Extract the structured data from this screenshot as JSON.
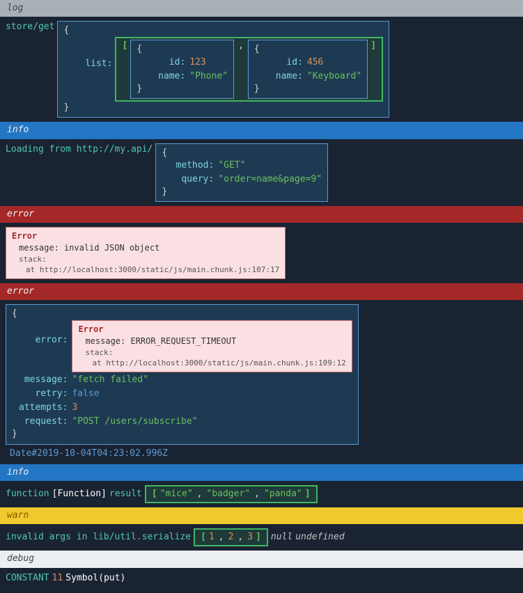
{
  "sections": {
    "log": {
      "header": "log",
      "prefix": "store/get",
      "obj": {
        "list_key": "list:",
        "items": [
          {
            "id_key": "id:",
            "id_val": "123",
            "name_key": "name:",
            "name_val": "\"Phone\""
          },
          {
            "id_key": "id:",
            "id_val": "456",
            "name_key": "name:",
            "name_val": "\"Keyboard\""
          }
        ]
      }
    },
    "info1": {
      "header": "info",
      "prefix": "Loading from http://my.api/",
      "obj": {
        "method_key": "method:",
        "method_val": "\"GET\"",
        "query_key": "query:",
        "query_val": "\"order=name&page=9\""
      }
    },
    "error1": {
      "header": "error",
      "error": {
        "title": "Error",
        "message_label": "message:",
        "message": "invalid JSON object",
        "stack_label": "stack:",
        "stack_line": "at http://localhost:3000/static/js/main.chunk.js:107:17"
      }
    },
    "error2": {
      "header": "error",
      "date": "Date#2019-10-04T04:23:02.996Z",
      "obj": {
        "error_key": "error:",
        "inner_error": {
          "title": "Error",
          "message_label": "message:",
          "message": "ERROR_REQUEST_TIMEOUT",
          "stack_label": "stack:",
          "stack_line": "at http://localhost:3000/static/js/main.chunk.js:109:12"
        },
        "message_key": "message:",
        "message_val": "\"fetch failed\"",
        "retry_key": "retry:",
        "retry_val": "false",
        "attempts_key": "attempts:",
        "attempts_val": "3",
        "request_key": "request:",
        "request_val": "\"POST /users/subscribe\""
      }
    },
    "info2": {
      "header": "info",
      "t1": "function",
      "t2": "[Function]",
      "t3": "result",
      "arr": [
        "\"mice\"",
        "\"badger\"",
        "\"panda\""
      ]
    },
    "warn": {
      "header": "warn",
      "t1": "invalid args in lib/util.serialize",
      "arr": [
        "1",
        "2",
        "3"
      ],
      "post_null": "null",
      "post_undef": "undefined"
    },
    "debug": {
      "header": "debug",
      "t1": "CONSTANT",
      "t2": "11",
      "t3": "Symbol(put)"
    }
  },
  "open_brace": "{",
  "close_brace": "}",
  "open_bracket": "[",
  "close_bracket": "]",
  "comma": ","
}
